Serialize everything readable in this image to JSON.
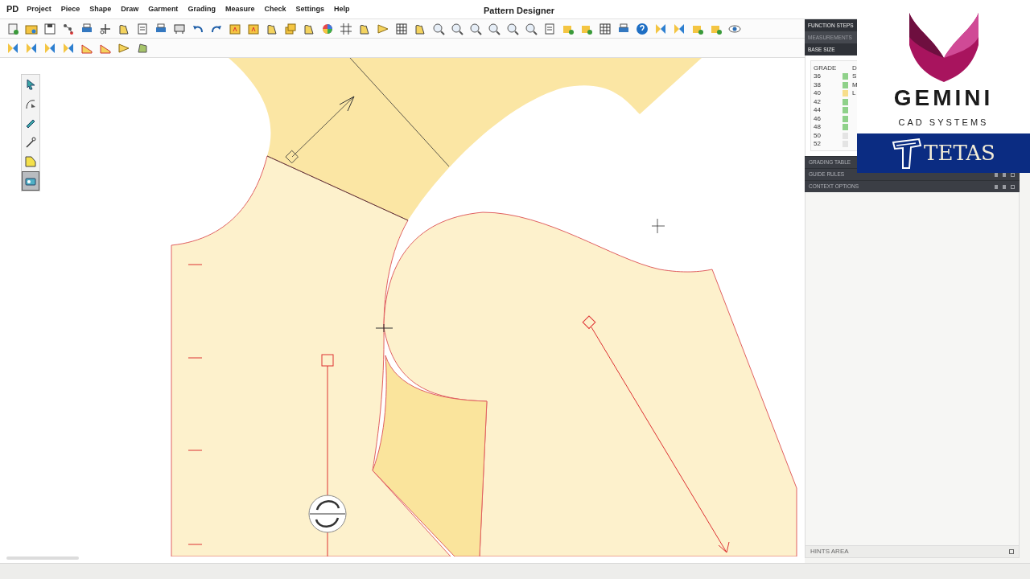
{
  "app_badge": "PD",
  "menu": [
    "Project",
    "Piece",
    "Shape",
    "Draw",
    "Garment",
    "Grading",
    "Measure",
    "Check",
    "Settings",
    "Help"
  ],
  "window": {
    "title": "Pattern Designer"
  },
  "tool_palette": [
    {
      "selected": false
    },
    {
      "selected": false
    },
    {
      "selected": false
    },
    {
      "selected": false
    },
    {
      "selected": false
    },
    {
      "selected": true
    }
  ],
  "side_tabs": [
    {
      "label": "FUNCTION STEPS",
      "selected": true
    },
    {
      "label": "MEASUREMENTS",
      "selected": false
    },
    {
      "label": "BASE SIZE",
      "selected": true
    }
  ],
  "grade_table": {
    "columns": [
      "GRADE",
      "D"
    ],
    "rows": [
      {
        "size": "36",
        "color": "#8fd18a",
        "code": "S"
      },
      {
        "size": "38",
        "color": "#8fd18a",
        "code": "M"
      },
      {
        "size": "40",
        "color": "#f7de8c",
        "code": "L"
      },
      {
        "size": "42",
        "color": "#8fd18a"
      },
      {
        "size": "44",
        "color": "#8fd18a"
      },
      {
        "size": "46",
        "color": "#8fd18a"
      },
      {
        "size": "48",
        "color": "#8fd18a"
      },
      {
        "size": "50",
        "color": "#e4e4e4"
      },
      {
        "size": "52",
        "color": "#e4e4e4"
      }
    ]
  },
  "panel_sections": [
    "GRADING TABLE",
    "GUIDE RULES",
    "CONTEXT OPTIONS"
  ],
  "hints": {
    "label": "HINTS AREA"
  },
  "logo": {
    "name": "GEMINI",
    "tagline": "CAD SYSTEMS",
    "partner": "TETAS"
  }
}
